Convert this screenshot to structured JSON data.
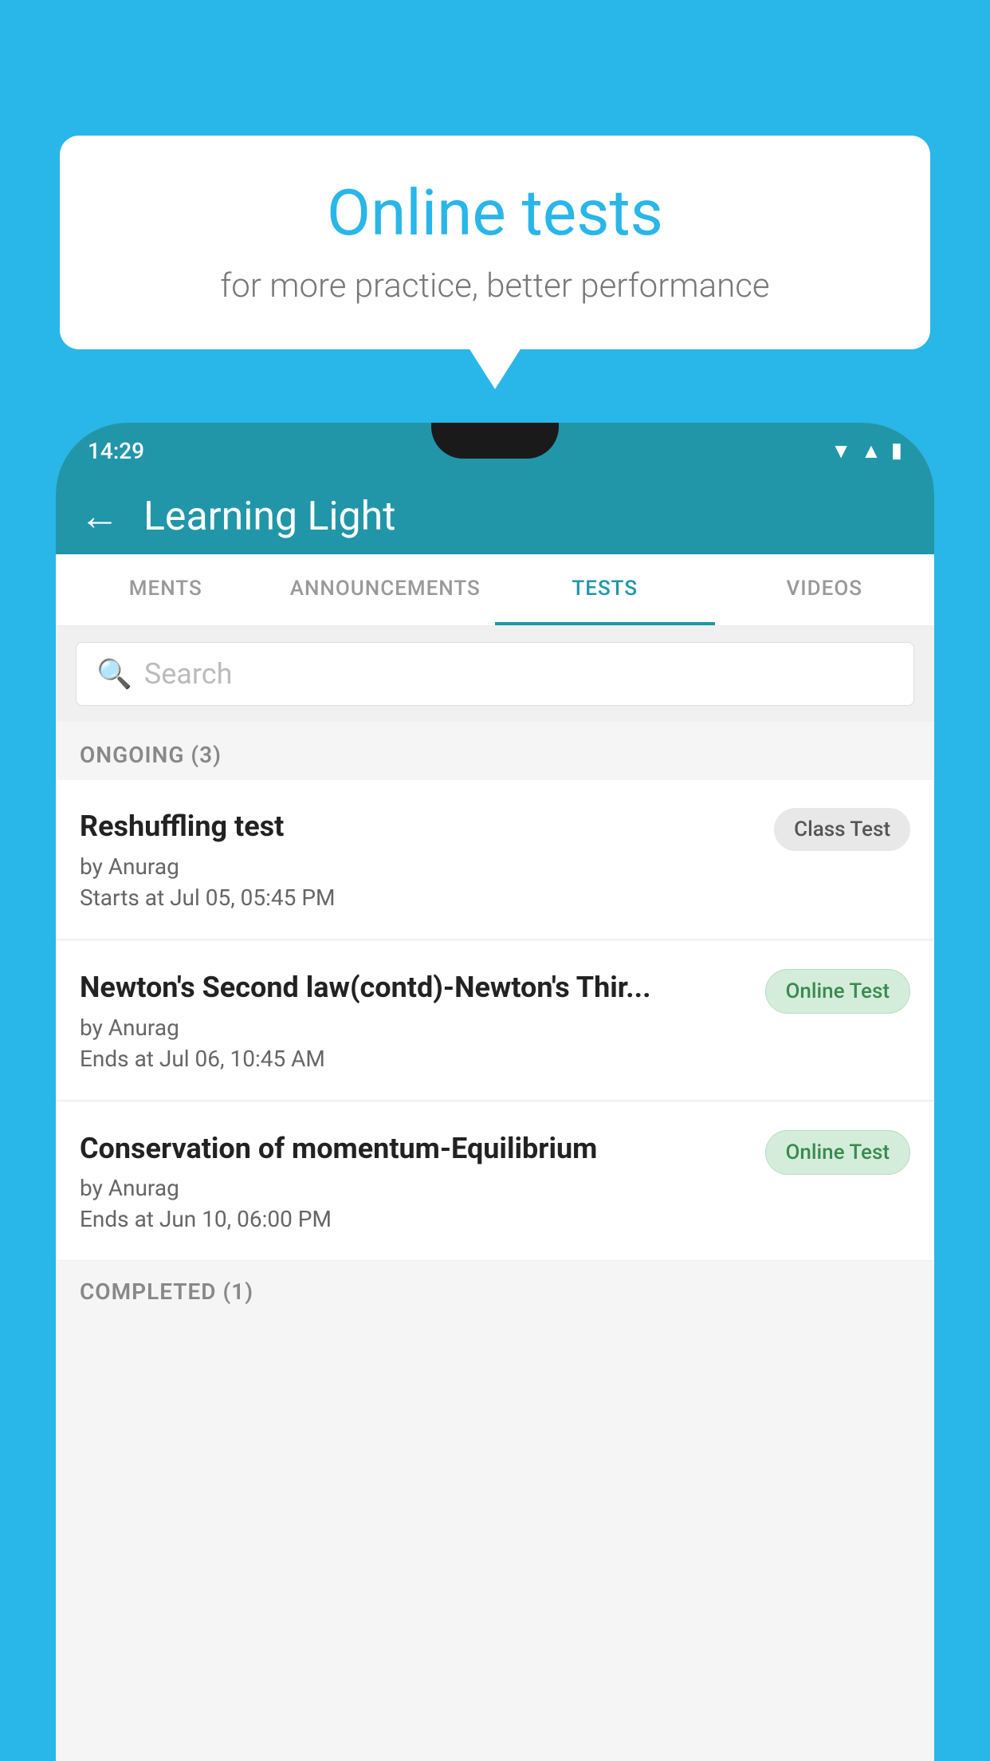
{
  "background": {
    "color": "#29B6E8"
  },
  "speech_bubble": {
    "title": "Online tests",
    "subtitle": "for more practice, better performance"
  },
  "phone": {
    "status_bar": {
      "time": "14:29",
      "icons": [
        "wifi",
        "signal",
        "battery"
      ]
    },
    "app_header": {
      "title": "Learning Light",
      "back_label": "←"
    },
    "tabs": [
      {
        "label": "MENTS",
        "active": false
      },
      {
        "label": "ANNOUNCEMENTS",
        "active": false
      },
      {
        "label": "TESTS",
        "active": true
      },
      {
        "label": "VIDEOS",
        "active": false
      }
    ],
    "search": {
      "placeholder": "Search"
    },
    "ongoing_section": {
      "label": "ONGOING (3)"
    },
    "tests": [
      {
        "name": "Reshuffling test",
        "by": "by Anurag",
        "date": "Starts at  Jul 05, 05:45 PM",
        "badge": "Class Test",
        "badge_type": "class"
      },
      {
        "name": "Newton's Second law(contd)-Newton's Thir...",
        "by": "by Anurag",
        "date": "Ends at  Jul 06, 10:45 AM",
        "badge": "Online Test",
        "badge_type": "online"
      },
      {
        "name": "Conservation of momentum-Equilibrium",
        "by": "by Anurag",
        "date": "Ends at  Jun 10, 06:00 PM",
        "badge": "Online Test",
        "badge_type": "online"
      }
    ],
    "completed_section": {
      "label": "COMPLETED (1)"
    }
  }
}
